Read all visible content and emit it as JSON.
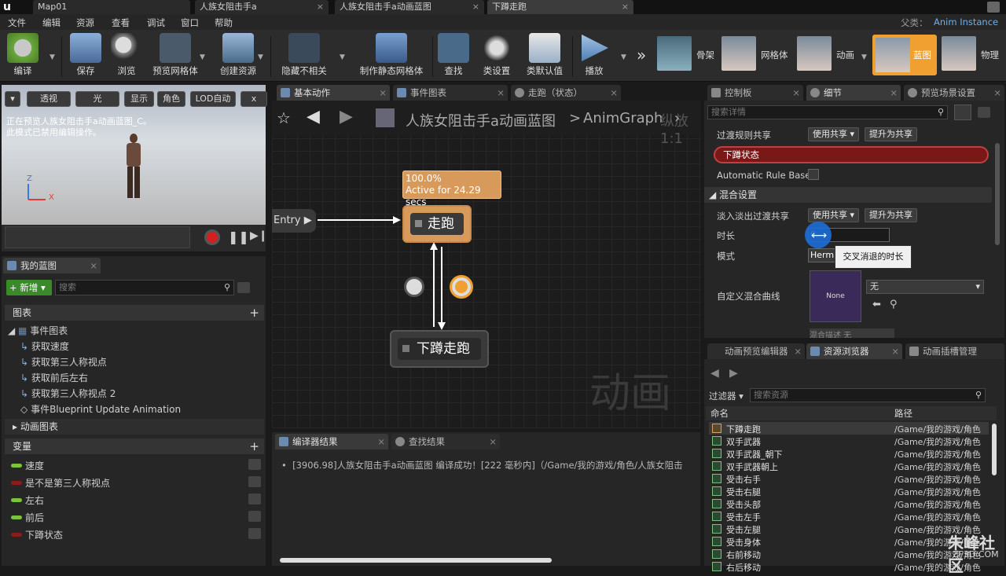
{
  "titlebar": {
    "tabs": [
      "Map01",
      "人族女阻击手a",
      "人族女阻击手a动画蓝图",
      "下蹲走跑"
    ],
    "parent_label": "父类：",
    "parent_value": "Anim Instance"
  },
  "menu": [
    "文件",
    "编辑",
    "资源",
    "查看",
    "调试",
    "窗口",
    "帮助"
  ],
  "toolbar": {
    "buttons": [
      "编译",
      "保存",
      "浏览",
      "预览网格体",
      "创建资源",
      "隐藏不相关",
      "制作静态网格体",
      "查找",
      "类设置",
      "类默认值",
      "播放"
    ],
    "modes": [
      "骨架",
      "网格体",
      "动画",
      "蓝图",
      "物理"
    ],
    "overflow": "»"
  },
  "viewport": {
    "btns": [
      "透视",
      "光",
      "显示",
      "角色",
      "LOD自动",
      "x"
    ],
    "overlay_line1": "正在预览人族女阻击手a动画蓝图_C。",
    "overlay_line2": "此模式已禁用编辑操作。",
    "axis_z": "Z",
    "axis_x": "X"
  },
  "my_blueprint": {
    "tab": "我的蓝图",
    "new_label": "新增",
    "search_placeholder": "搜索",
    "graphs_header": "图表",
    "event_graph": "事件图表",
    "event_items": [
      "获取速度",
      "获取第三人称视点",
      "获取前后左右",
      "获取第三人称视点 2",
      "事件Blueprint Update Animation"
    ],
    "anim_graph": "动画图表",
    "vars_header": "变量",
    "variables": [
      {
        "name": "速度",
        "color": "#7ac33a"
      },
      {
        "name": "是不是第三人称视点",
        "color": "#8a1c1c"
      },
      {
        "name": "左右",
        "color": "#7ac33a"
      },
      {
        "name": "前后",
        "color": "#7ac33a"
      },
      {
        "name": "下蹲状态",
        "color": "#8a1c1c"
      }
    ]
  },
  "graph": {
    "tabs": [
      "基本动作",
      "事件图表",
      "走跑（状态）"
    ],
    "breadcrumb": "人族女阻击手a动画蓝图",
    "breadcrumb_sep": ">",
    "breadcrumb_current": "AnimGraph",
    "entry": "Entry",
    "tooltip_pct": "100.0%",
    "tooltip_active": "Active for 24.29 secs",
    "node_run": "走跑",
    "node_crouch": "下蹲走跑",
    "watermark": "动画",
    "cut_text": "纵放 1:1"
  },
  "compiler": {
    "tabs": [
      "编译器结果",
      "查找结果"
    ],
    "message": "[3906.98]人族女阻击手a动画蓝图 编译成功！[222 毫秒内]（/Game/我的游戏/角色/人族女阻击"
  },
  "details_tabs": [
    "控制板",
    "细节",
    "预览场景设置"
  ],
  "details": {
    "search_placeholder": "搜索详情",
    "transition_share_label": "过渡规则共享",
    "use_shared": "使用共享",
    "promote_shared": "提升为共享",
    "rule_name": "下蹲状态",
    "auto_rule": "Automatic Rule Based",
    "blend_header": "混合设置",
    "blend_share_label": "淡入淡出过渡共享",
    "duration_label": "时长",
    "duration_value": "0.",
    "mode_label": "模式",
    "mode_value": "Herm",
    "tooltip": "交叉消退的时长",
    "curve_label": "自定义混合曲线",
    "curve_thumb": "None",
    "curve_value": "无",
    "cut_label": "混合描述",
    "cut_value": "无"
  },
  "bottom_tabs": [
    "动画预览编辑器",
    "资源浏览器",
    "动画插槽管理"
  ],
  "asset_browser": {
    "filter_label": "过滤器",
    "search_placeholder": "搜索资源",
    "col_name": "命名",
    "col_path": "路径",
    "rows": [
      {
        "name": "下蹲走跑",
        "path": "/Game/我的游戏/角色"
      },
      {
        "name": "双手武器",
        "path": "/Game/我的游戏/角色"
      },
      {
        "name": "双手武器_朝下",
        "path": "/Game/我的游戏/角色"
      },
      {
        "name": "双手武器朝上",
        "path": "/Game/我的游戏/角色"
      },
      {
        "name": "受击右手",
        "path": "/Game/我的游戏/角色"
      },
      {
        "name": "受击右腿",
        "path": "/Game/我的游戏/角色"
      },
      {
        "name": "受击头部",
        "path": "/Game/我的游戏/角色"
      },
      {
        "name": "受击左手",
        "path": "/Game/我的游戏/角色"
      },
      {
        "name": "受击左腿",
        "path": "/Game/我的游戏/角色"
      },
      {
        "name": "受击身体",
        "path": "/Game/我的游戏/角色"
      },
      {
        "name": "右前移动",
        "path": "/Game/我的游戏/角色"
      },
      {
        "name": "右后移动",
        "path": "/Game/我的游戏/角色"
      }
    ],
    "watermark_brand": "朱峰社区",
    "watermark_url": "ZF3D.COM"
  },
  "colors": {
    "accent": "#f0a030",
    "node": "#d8a060",
    "rule": "#7a1818",
    "cursor": "#1e6ed8"
  }
}
